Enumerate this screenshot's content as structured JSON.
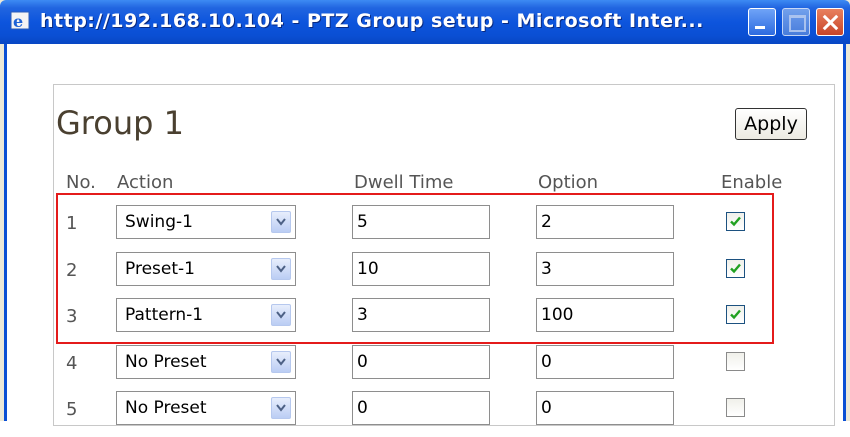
{
  "window": {
    "title": "http://192.168.10.104 - PTZ Group setup - Microsoft Inter...",
    "title_bar_color": "#0A4FD4"
  },
  "page": {
    "group_title": "Group 1",
    "apply_label": "Apply"
  },
  "table": {
    "headers": {
      "no": "No.",
      "action": "Action",
      "dwell": "Dwell Time",
      "option": "Option",
      "enable": "Enable"
    },
    "rows": [
      {
        "no": "1",
        "action": "Swing-1",
        "dwell": "5",
        "option": "2",
        "enabled": true
      },
      {
        "no": "2",
        "action": "Preset-1",
        "dwell": "10",
        "option": "3",
        "enabled": true
      },
      {
        "no": "3",
        "action": "Pattern-1",
        "dwell": "3",
        "option": "100",
        "enabled": true
      },
      {
        "no": "4",
        "action": "No Preset",
        "dwell": "0",
        "option": "0",
        "enabled": false
      },
      {
        "no": "5",
        "action": "No Preset",
        "dwell": "0",
        "option": "0",
        "enabled": false
      }
    ]
  },
  "annotation": {
    "highlight_color": "#E41B1B"
  },
  "icons": {
    "browser": "ie-icon",
    "minimize": "minimize-icon",
    "maximize": "maximize-icon",
    "close": "close-icon",
    "dropdown": "chevron-down-icon",
    "checkbox_check": "check-icon"
  }
}
